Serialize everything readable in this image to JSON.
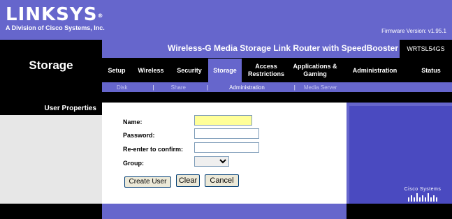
{
  "header": {
    "logo_text": "LINKSYS",
    "logo_reg": "®",
    "tagline": "A Division of Cisco Systems, Inc.",
    "firmware": "Firmware Version: v1.95.1"
  },
  "model": {
    "title": "Wireless-G Media Storage Link Router with SpeedBooster",
    "id": "WRTSL54GS"
  },
  "section_title": "Storage",
  "tabs": [
    {
      "label": "Setup"
    },
    {
      "label": "Wireless"
    },
    {
      "label": "Security"
    },
    {
      "label": "Storage"
    },
    {
      "label": "Access Restrictions"
    },
    {
      "label": "Applications & Gaming"
    },
    {
      "label": "Administration"
    },
    {
      "label": "Status"
    }
  ],
  "subtabs": [
    {
      "label": "Disk"
    },
    {
      "label": "Share"
    },
    {
      "label": "Administration"
    },
    {
      "label": "Media Server"
    }
  ],
  "left_panel": {
    "title": "User Properties"
  },
  "form": {
    "name_label": "Name:",
    "name_value": "",
    "password_label": "Password:",
    "password_value": "",
    "confirm_label": "Re-enter to confirm:",
    "confirm_value": "",
    "group_label": "Group:",
    "group_value": "",
    "create_user_label": "Create User",
    "clear_label": "Clear",
    "cancel_label": "Cancel"
  },
  "cisco": {
    "text": "Cisco Systems"
  },
  "colors": {
    "brand_purple": "#6666cc",
    "black": "#000000",
    "name_field_highlight": "#ffff99"
  }
}
